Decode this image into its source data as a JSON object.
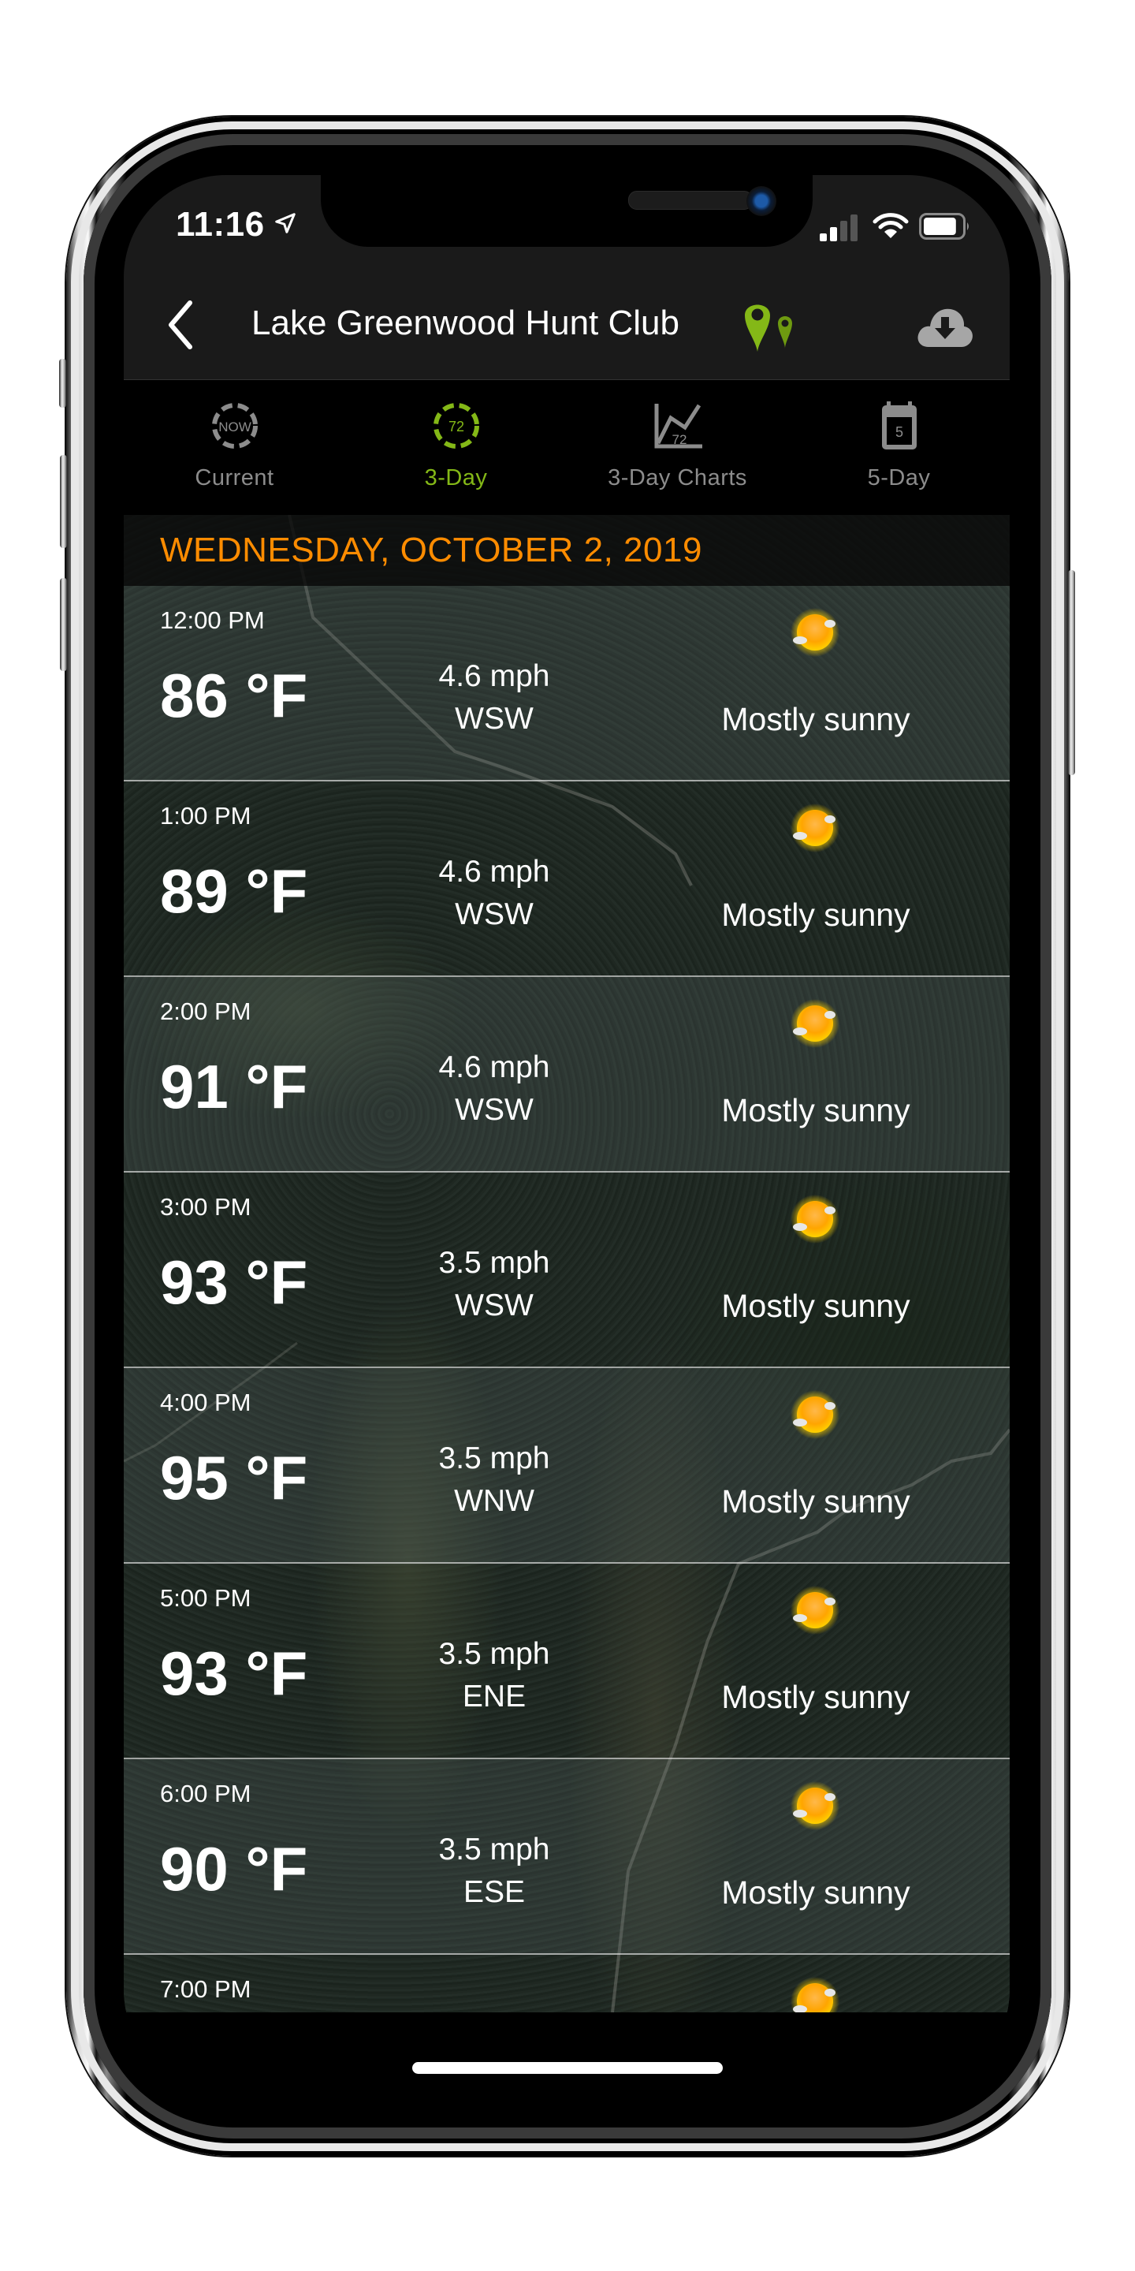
{
  "status_bar": {
    "time": "11:16",
    "location_icon": "location-arrow-icon",
    "signal_bars_active": 2,
    "signal_bars_total": 4,
    "wifi_icon": "wifi-icon",
    "battery_level": 0.85
  },
  "nav": {
    "back_icon": "chevron-left-icon",
    "title": "Lake Greenwood Hunt Club",
    "title_icon": "map-pins-icon",
    "action_icon": "cloud-download-icon"
  },
  "tabs": [
    {
      "label": "Current",
      "icon": "now-dial-icon",
      "icon_text": "NOW",
      "active": false
    },
    {
      "label": "3-Day",
      "icon": "72-dial-icon",
      "icon_text": "72",
      "active": true
    },
    {
      "label": "3-Day Charts",
      "icon": "line-chart-icon",
      "icon_text": "72",
      "active": false
    },
    {
      "label": "5-Day",
      "icon": "calendar-icon",
      "icon_text": "5",
      "active": false
    }
  ],
  "colors": {
    "accent_green": "#84b817",
    "date_orange": "#ff8c00",
    "tab_inactive": "#8c8c8c",
    "nav_bg": "#1a1a1a"
  },
  "forecast": {
    "date_heading": "WEDNESDAY, OCTOBER 2, 2019",
    "hours": [
      {
        "time": "12:00 PM",
        "temp": "86 °F",
        "wind_speed": "4.6 mph",
        "wind_dir": "WSW",
        "condition": "Mostly sunny",
        "icon": "mostly-sunny-icon"
      },
      {
        "time": "1:00 PM",
        "temp": "89 °F",
        "wind_speed": "4.6 mph",
        "wind_dir": "WSW",
        "condition": "Mostly sunny",
        "icon": "mostly-sunny-icon"
      },
      {
        "time": "2:00 PM",
        "temp": "91 °F",
        "wind_speed": "4.6 mph",
        "wind_dir": "WSW",
        "condition": "Mostly sunny",
        "icon": "mostly-sunny-icon"
      },
      {
        "time": "3:00 PM",
        "temp": "93 °F",
        "wind_speed": "3.5 mph",
        "wind_dir": "WSW",
        "condition": "Mostly sunny",
        "icon": "mostly-sunny-icon"
      },
      {
        "time": "4:00 PM",
        "temp": "95 °F",
        "wind_speed": "3.5 mph",
        "wind_dir": "WNW",
        "condition": "Mostly sunny",
        "icon": "mostly-sunny-icon"
      },
      {
        "time": "5:00 PM",
        "temp": "93 °F",
        "wind_speed": "3.5 mph",
        "wind_dir": "ENE",
        "condition": "Mostly sunny",
        "icon": "mostly-sunny-icon"
      },
      {
        "time": "6:00 PM",
        "temp": "90 °F",
        "wind_speed": "3.5 mph",
        "wind_dir": "ESE",
        "condition": "Mostly sunny",
        "icon": "mostly-sunny-icon"
      },
      {
        "time": "7:00 PM",
        "temp": "",
        "wind_speed": "",
        "wind_dir": "",
        "condition": "",
        "icon": "mostly-sunny-icon"
      }
    ]
  }
}
